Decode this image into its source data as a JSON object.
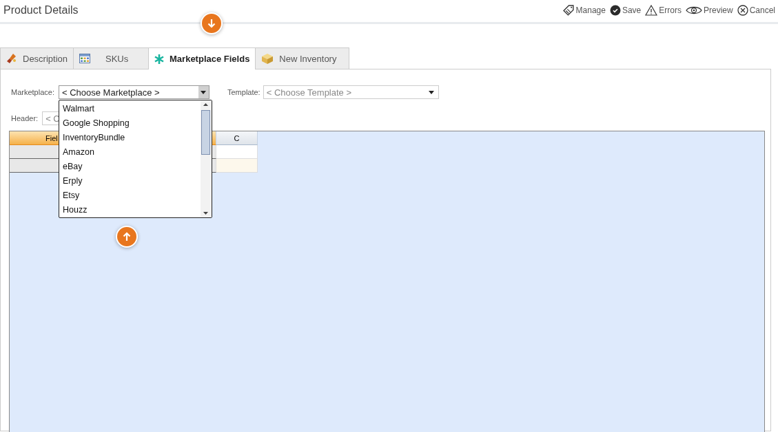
{
  "page_title": "Product Details",
  "toolbar": [
    {
      "kind": "manage",
      "label": "Manage"
    },
    {
      "kind": "save",
      "label": "Save"
    },
    {
      "kind": "errors",
      "label": "Errors"
    },
    {
      "kind": "preview",
      "label": "Preview"
    },
    {
      "kind": "cancel",
      "label": "Cancel"
    }
  ],
  "tabs": [
    {
      "kind": "description",
      "label": "Description",
      "selected": false
    },
    {
      "kind": "skus",
      "label": "SKUs",
      "selected": false
    },
    {
      "kind": "marketplace",
      "label": "Marketplace Fields",
      "selected": true
    },
    {
      "kind": "inventory",
      "label": "New Inventory",
      "selected": false
    }
  ],
  "marketplace": {
    "label": "Marketplace:",
    "value": "< Choose Marketplace >",
    "expanded": true,
    "options": [
      "Walmart",
      "Google Shopping",
      "InventoryBundle",
      "Amazon",
      "eBay",
      "Erply",
      "Etsy",
      "Houzz"
    ]
  },
  "template": {
    "label": "Template:",
    "placeholder": "< Choose Template >"
  },
  "header": {
    "label": "Header:",
    "value": "< C"
  },
  "grid": {
    "columns": [
      "Fiel",
      "C"
    ]
  }
}
